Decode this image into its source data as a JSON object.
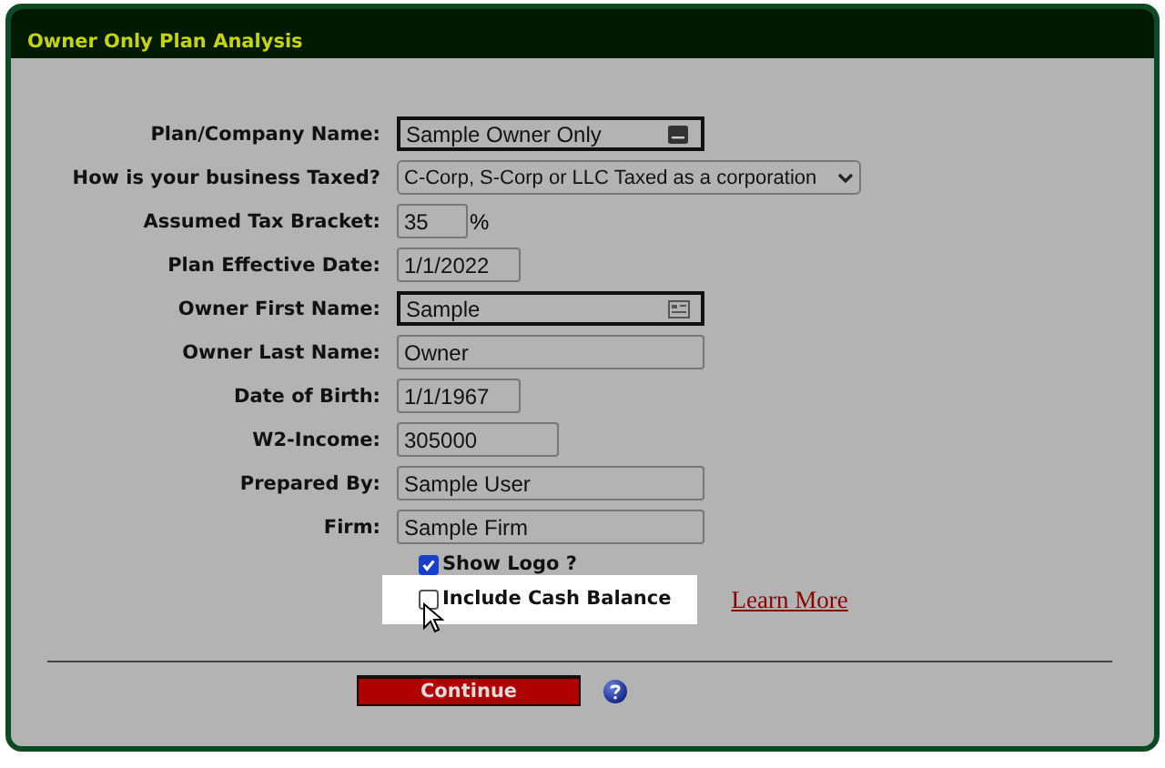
{
  "panel": {
    "title": "Owner Only Plan Analysis"
  },
  "fields": [
    {
      "label": "Plan/Company Name:",
      "kind": "name-autofill",
      "value": "Sample Owner Only"
    },
    {
      "label": "How is your business Taxed?",
      "kind": "select",
      "value": "C-Corp, S-Corp or LLC Taxed as a corporation"
    },
    {
      "label": "Assumed Tax Bracket:",
      "kind": "text",
      "value": "35",
      "suffix": "%"
    },
    {
      "label": "Plan Effective Date:",
      "kind": "text",
      "value": "1/1/2022"
    },
    {
      "label": "Owner First Name:",
      "kind": "contact-autofill",
      "value": "Sample"
    },
    {
      "label": "Owner Last Name:",
      "kind": "text",
      "value": "Owner"
    },
    {
      "label": "Date of Birth:",
      "kind": "text",
      "value": "1/1/1967"
    },
    {
      "label": "W2-Income:",
      "kind": "text",
      "value": "305000"
    },
    {
      "label": "Prepared By:",
      "kind": "text",
      "value": "Sample User"
    },
    {
      "label": "Firm:",
      "kind": "text",
      "value": "Sample Firm"
    }
  ],
  "checkboxes": [
    {
      "label": "Show Logo ?",
      "checked": true,
      "highlighted": false
    },
    {
      "label": "Include Cash Balance",
      "checked": false,
      "highlighted": true,
      "link": "Learn More"
    }
  ],
  "buttons": [
    {
      "label": "Continue"
    }
  ]
}
